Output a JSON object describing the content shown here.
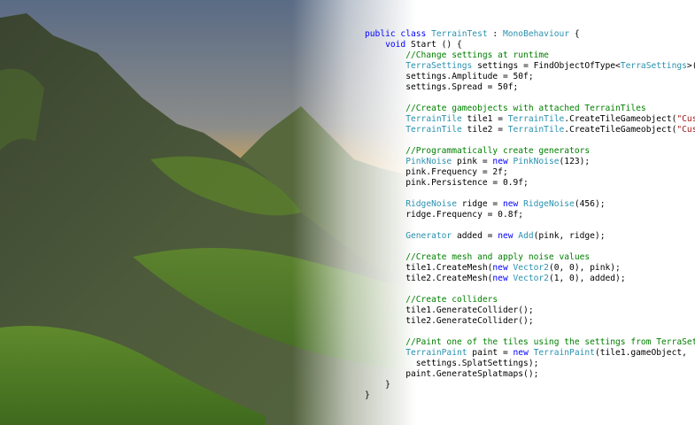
{
  "scene": {
    "description_colors": {
      "sky_top": "#5d6e86",
      "sky_glow": "#f2b13c",
      "terrain_dark": "#3e4a2f",
      "grass": "#5f8a2c"
    }
  },
  "code": {
    "lines": [
      [
        [
          "k",
          "public class "
        ],
        [
          "t",
          "TerrainTest"
        ],
        [
          "p",
          " : "
        ],
        [
          "t",
          "MonoBehaviour"
        ],
        [
          "p",
          " {"
        ]
      ],
      [
        [
          "p",
          "    "
        ],
        [
          "k",
          "void"
        ],
        [
          "p",
          " Start () {"
        ]
      ],
      [
        [
          "c",
          "        //Change settings at runtime"
        ]
      ],
      [
        [
          "p",
          "        "
        ],
        [
          "t",
          "TerraSettings"
        ],
        [
          "p",
          " settings = FindObjectOfType<"
        ],
        [
          "t",
          "TerraSettings"
        ],
        [
          "p",
          ">();"
        ]
      ],
      [
        [
          "p",
          "        settings.Amplitude = 50f;"
        ]
      ],
      [
        [
          "p",
          "        settings.Spread = 50f;"
        ]
      ],
      [
        [
          "p",
          ""
        ]
      ],
      [
        [
          "c",
          "        //Create gameobjects with attached TerrainTiles"
        ]
      ],
      [
        [
          "p",
          "        "
        ],
        [
          "t",
          "TerrainTile"
        ],
        [
          "p",
          " tile1 = "
        ],
        [
          "t",
          "TerrainTile"
        ],
        [
          "p",
          ".CreateTileGameobject("
        ],
        [
          "s",
          "\"Custom Ti"
        ]
      ],
      [
        [
          "p",
          "        "
        ],
        [
          "t",
          "TerrainTile"
        ],
        [
          "p",
          " tile2 = "
        ],
        [
          "t",
          "TerrainTile"
        ],
        [
          "p",
          ".CreateTileGameobject("
        ],
        [
          "s",
          "\"Custom Ti"
        ]
      ],
      [
        [
          "p",
          ""
        ]
      ],
      [
        [
          "c",
          "        //Programmatically create generators"
        ]
      ],
      [
        [
          "p",
          "        "
        ],
        [
          "t",
          "PinkNoise"
        ],
        [
          "p",
          " pink = "
        ],
        [
          "k",
          "new"
        ],
        [
          "p",
          " "
        ],
        [
          "t",
          "PinkNoise"
        ],
        [
          "p",
          "(123);"
        ]
      ],
      [
        [
          "p",
          "        pink.Frequency = 2f;"
        ]
      ],
      [
        [
          "p",
          "        pink.Persistence = 0.9f;"
        ]
      ],
      [
        [
          "p",
          ""
        ]
      ],
      [
        [
          "p",
          "        "
        ],
        [
          "t",
          "RidgeNoise"
        ],
        [
          "p",
          " ridge = "
        ],
        [
          "k",
          "new"
        ],
        [
          "p",
          " "
        ],
        [
          "t",
          "RidgeNoise"
        ],
        [
          "p",
          "(456);"
        ]
      ],
      [
        [
          "p",
          "        ridge.Frequency = 0.8f;"
        ]
      ],
      [
        [
          "p",
          ""
        ]
      ],
      [
        [
          "p",
          "        "
        ],
        [
          "t",
          "Generator"
        ],
        [
          "p",
          " added = "
        ],
        [
          "k",
          "new"
        ],
        [
          "p",
          " "
        ],
        [
          "t",
          "Add"
        ],
        [
          "p",
          "(pink, ridge);"
        ]
      ],
      [
        [
          "p",
          ""
        ]
      ],
      [
        [
          "c",
          "        //Create mesh and apply noise values"
        ]
      ],
      [
        [
          "p",
          "        tile1.CreateMesh("
        ],
        [
          "k",
          "new"
        ],
        [
          "p",
          " "
        ],
        [
          "t",
          "Vector2"
        ],
        [
          "p",
          "(0, 0), pink);"
        ]
      ],
      [
        [
          "p",
          "        tile2.CreateMesh("
        ],
        [
          "k",
          "new"
        ],
        [
          "p",
          " "
        ],
        [
          "t",
          "Vector2"
        ],
        [
          "p",
          "(1, 0), added);"
        ]
      ],
      [
        [
          "p",
          ""
        ]
      ],
      [
        [
          "c",
          "        //Create colliders"
        ]
      ],
      [
        [
          "p",
          "        tile1.GenerateCollider();"
        ]
      ],
      [
        [
          "p",
          "        tile2.GenerateCollider();"
        ]
      ],
      [
        [
          "p",
          ""
        ]
      ],
      [
        [
          "c",
          "        //Paint one of the tiles using the settings from TerraSettings"
        ]
      ],
      [
        [
          "p",
          "        "
        ],
        [
          "t",
          "TerrainPaint"
        ],
        [
          "p",
          " paint = "
        ],
        [
          "k",
          "new"
        ],
        [
          "p",
          " "
        ],
        [
          "t",
          "TerrainPaint"
        ],
        [
          "p",
          "(tile1.gameObject,"
        ]
      ],
      [
        [
          "p",
          "          settings.SplatSettings);"
        ]
      ],
      [
        [
          "p",
          "        paint.GenerateSplatmaps();"
        ]
      ],
      [
        [
          "p",
          "    }"
        ]
      ],
      [
        [
          "p",
          "}"
        ]
      ]
    ]
  }
}
